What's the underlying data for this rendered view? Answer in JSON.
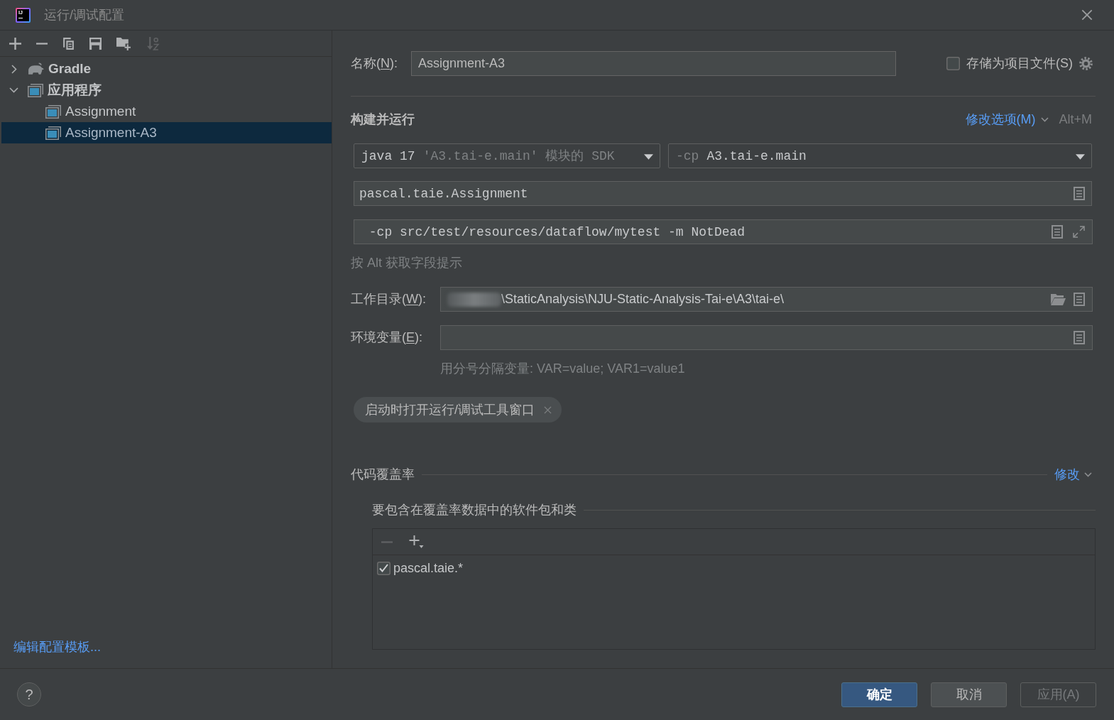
{
  "window": {
    "title": "运行/调试配置",
    "logo_text": "IJ"
  },
  "toolbar": [
    {
      "kind": "add",
      "disabled": false
    },
    {
      "kind": "remove",
      "disabled": false
    },
    {
      "kind": "copy",
      "disabled": false
    },
    {
      "kind": "save",
      "disabled": false
    },
    {
      "kind": "new_folder",
      "disabled": false
    },
    {
      "kind": "sort",
      "disabled": true
    }
  ],
  "tree": [
    {
      "label": "Gradle",
      "kind": "gradle",
      "expanded": false,
      "selected": false
    },
    {
      "label": "应用程序",
      "kind": "application",
      "expanded": true,
      "selected": false,
      "children": [
        {
          "label": "Assignment",
          "kind": "application",
          "selected": false
        },
        {
          "label": "Assignment-A3",
          "kind": "application",
          "selected": true
        }
      ]
    }
  ],
  "edit_templates_link": "编辑配置模板...",
  "name_field": {
    "label": {
      "before": "名称(",
      "mnemonic": "N",
      "after": "):"
    },
    "value": "Assignment-A3"
  },
  "store_as_project_file": {
    "label": "存储为项目文件(S)",
    "checked": false
  },
  "build_and_run": {
    "title": "构建并运行",
    "modify_options": "修改选项(M)",
    "shortcut": "Alt+M",
    "sdk": {
      "value": "java 17",
      "hint": "'A3.tai-e.main' 模块的 SDK"
    },
    "classpath": {
      "prefix": "-cp",
      "value": "A3.tai-e.main"
    },
    "main_class": "pascal.taie.Assignment",
    "program_arguments": " -cp src/test/resources/dataflow/mytest -m NotDead",
    "hint": "按 Alt 获取字段提示"
  },
  "working_directory": {
    "label": {
      "before": "工作目录(",
      "mnemonic": "W",
      "after": "):"
    },
    "value": "\\StaticAnalysis\\NJU-Static-Analysis-Tai-e\\A3\\tai-e\\",
    "blurred_prefix": true
  },
  "environment_variables": {
    "label": {
      "before": "环境变量(",
      "mnemonic": "E",
      "after": "):"
    },
    "hint": "用分号分隔变量: VAR=value; VAR1=value1"
  },
  "tags": [
    {
      "label": "启动时打开运行/调试工具窗口"
    }
  ],
  "code_coverage": {
    "title": "代码覆盖率",
    "modify": "修改",
    "packages": {
      "title": "要包含在覆盖率数据中的软件包和类",
      "toolbar": [
        {
          "kind": "remove",
          "disabled": true
        },
        {
          "kind": "add_menu",
          "disabled": false
        }
      ],
      "items": [
        {
          "label": "pascal.taie.*",
          "checked": true
        }
      ]
    }
  },
  "help_button": "?",
  "buttons": [
    {
      "label": "确定",
      "kind": "primary",
      "disabled": false
    },
    {
      "label": "取消",
      "kind": "secondary",
      "disabled": false
    },
    {
      "label": "应用(A)",
      "kind": "secondary",
      "disabled": true
    }
  ]
}
